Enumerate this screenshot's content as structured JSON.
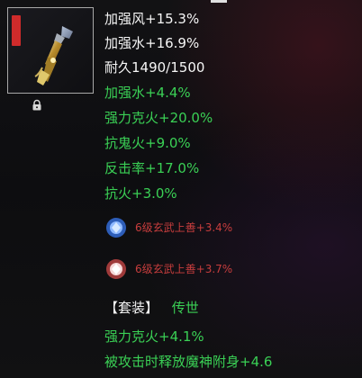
{
  "stats": {
    "line1": "加强风+15.3%",
    "line2": "加强水+16.9%",
    "line3": "耐久1490/1500",
    "line4": "加强水+4.4%",
    "line5": "强力克火+20.0%",
    "line6": "抗鬼火+9.0%",
    "line7": "反击率+17.0%",
    "line8": "抗火+3.0%"
  },
  "gems": {
    "gem1": "6级玄武上善+3.4%",
    "gem2": "6级玄武上善+3.7%"
  },
  "set": {
    "bracket": "【套装】",
    "name": "传世"
  },
  "setStats": {
    "line1": "强力克火+4.1%",
    "line2": "被攻击时释放魔神附身+4.6"
  },
  "colors": {
    "white_text": "#f6f6f6",
    "green_text": "#3ad055",
    "gem_text": "#c73d3d",
    "border": "#a8a8a8"
  },
  "icons": {
    "lock": "lock-icon",
    "item": "weapon-icon",
    "gem_blue": "blue-gem-icon",
    "gem_red": "red-gem-icon"
  }
}
